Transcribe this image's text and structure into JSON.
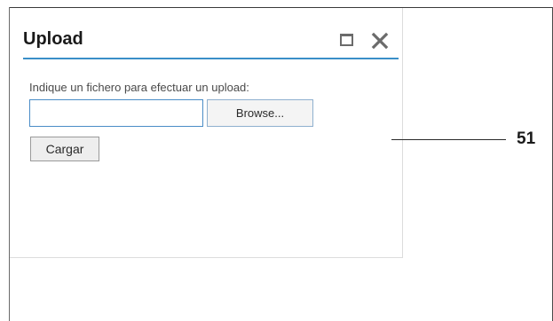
{
  "window": {
    "title": "Upload",
    "maximize_icon": "maximize-icon",
    "close_icon": "close-icon",
    "accent_color": "#3a8fc8"
  },
  "form": {
    "instruction": "Indique un fichero para efectuar un upload:",
    "file_value": "",
    "browse_label": "Browse...",
    "submit_label": "Cargar"
  },
  "callout": {
    "label": "51"
  }
}
